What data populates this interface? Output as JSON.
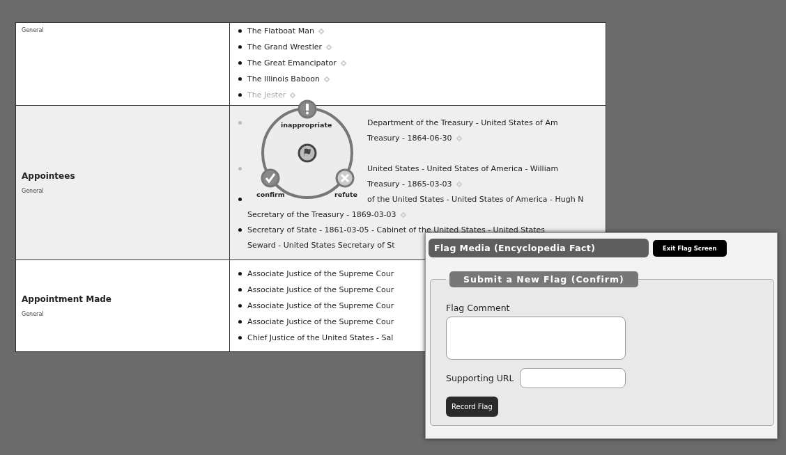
{
  "table": {
    "rows": [
      {
        "sublabel": "General",
        "items": [
          {
            "lines": [
              {
                "text": "The Flatboat Man",
                "covered": false,
                "faded": false
              }
            ],
            "faded": false,
            "pin": true
          },
          {
            "lines": [
              {
                "text": "The Grand Wrestler",
                "covered": false,
                "faded": false
              }
            ],
            "faded": false,
            "pin": true
          },
          {
            "lines": [
              {
                "text": "The Great Emancipator",
                "covered": false,
                "faded": false
              }
            ],
            "faded": false,
            "pin": true
          },
          {
            "lines": [
              {
                "text": "The Illinois Baboon",
                "covered": false,
                "faded": false
              }
            ],
            "faded": false,
            "pin": true
          },
          {
            "lines": [
              {
                "text": "The Jester",
                "covered": false,
                "faded": true
              }
            ],
            "faded": false,
            "pin": true
          }
        ]
      },
      {
        "label": "Appointees",
        "sublabel": "General",
        "items": [
          {
            "lines": [
              {
                "text": "Department of the Treasury - United States of Am",
                "covered": true,
                "faded": false
              },
              {
                "text": "Treasury - 1864-06-30",
                "covered": true,
                "faded": false
              }
            ],
            "faded": true,
            "pin": true
          },
          {
            "lines": [
              {
                "text": "United States - United States of America - William",
                "covered": true,
                "faded": false
              },
              {
                "text": "Treasury - 1865-03-03",
                "covered": true,
                "faded": false
              }
            ],
            "faded": true,
            "pin": true
          },
          {
            "lines": [
              {
                "text": "of the United States - United States of America - Hugh N",
                "covered": true,
                "faded": false
              },
              {
                "text": "Secretary of the Treasury - 1869-03-03",
                "covered": false,
                "faded": false
              }
            ],
            "faded": false,
            "pin": true
          },
          {
            "lines": [
              {
                "text": "Secretary of State - 1861-03-05 - Cabinet of the United States - United States",
                "covered": false,
                "faded": false
              },
              {
                "text": "Seward - United States Secretary of St",
                "covered": false,
                "faded": false
              }
            ],
            "faded": false,
            "pin": false
          }
        ]
      },
      {
        "label": "Appointment Made",
        "sublabel": "General",
        "items": [
          {
            "lines": [
              {
                "text": "Associate Justice of the Supreme Cour",
                "covered": false,
                "faded": false
              }
            ],
            "faded": false,
            "pin": false
          },
          {
            "lines": [
              {
                "text": "Associate Justice of the Supreme Cour",
                "covered": false,
                "faded": false
              }
            ],
            "faded": false,
            "pin": false
          },
          {
            "lines": [
              {
                "text": "Associate Justice of the Supreme Cour",
                "covered": false,
                "faded": false
              }
            ],
            "faded": false,
            "pin": false
          },
          {
            "lines": [
              {
                "text": "Associate Justice of the Supreme Cour",
                "covered": false,
                "faded": false
              }
            ],
            "faded": false,
            "pin": false
          },
          {
            "lines": [
              {
                "text": "Chief Justice of the United States - Sal",
                "covered": false,
                "faded": false
              }
            ],
            "faded": false,
            "pin": false
          }
        ]
      }
    ]
  },
  "radial_menu": {
    "options": [
      {
        "label": "inappropriate",
        "kind": "alert"
      },
      {
        "label": "confirm",
        "kind": "check"
      },
      {
        "label": "refute",
        "kind": "cross"
      }
    ]
  },
  "dialog": {
    "title": "Flag Media (Encyclopedia Fact)",
    "exit_button": "Exit Flag Screen",
    "section_title": "Submit a New Flag (Confirm)",
    "comment_label": "Flag Comment",
    "url_label": "Supporting URL",
    "submit_button": "Record Flag"
  }
}
